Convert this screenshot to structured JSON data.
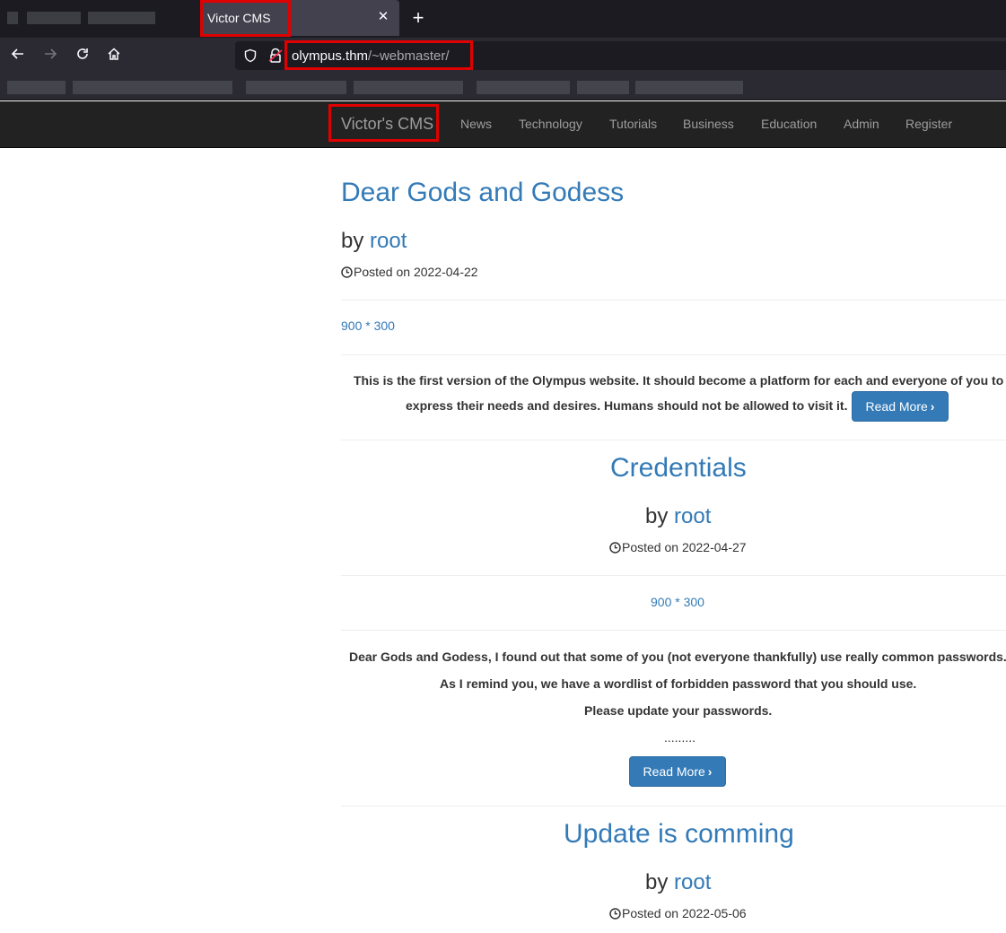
{
  "browser": {
    "tab": {
      "title": "Victor CMS",
      "close_icon": "close-icon"
    },
    "new_tab_icon": "plus-icon",
    "nav": {
      "back_icon": "arrow-left-icon",
      "forward_icon": "arrow-right-icon",
      "reload_icon": "reload-icon",
      "home_icon": "home-icon"
    },
    "url": {
      "host": "olympus.thm",
      "path": "/~webmaster/"
    }
  },
  "site": {
    "brand": "Victor's CMS",
    "nav_links": [
      "News",
      "Technology",
      "Tutorials",
      "Business",
      "Education",
      "Admin",
      "Register"
    ]
  },
  "posts": [
    {
      "title": "Dear Gods and Godess",
      "by": "by ",
      "author": "root",
      "posted": "Posted on 2022-04-22",
      "image_text": "900 * 300",
      "excerpt_lines": [
        "This is the first version of the Olympus website. It should become a platform for each and everyone of you to",
        "express their needs and desires. Humans should not be allowed to visit it."
      ],
      "read_more": "Read More"
    },
    {
      "title": "Credentials",
      "by": "by ",
      "author": "root",
      "posted": "Posted on 2022-04-27",
      "image_text": "900 * 300",
      "excerpt_lines": [
        "Dear Gods and Godess, I found out that some of you (not everyone thankfully) use really common passwords.",
        "As I remind you, we have a wordlist of forbidden password that you should use.",
        "Please update your passwords."
      ],
      "dots": ".........",
      "read_more": "Read More"
    },
    {
      "title": "Update is comming",
      "by": "by ",
      "author": "root",
      "posted": "Posted on 2022-05-06"
    }
  ]
}
